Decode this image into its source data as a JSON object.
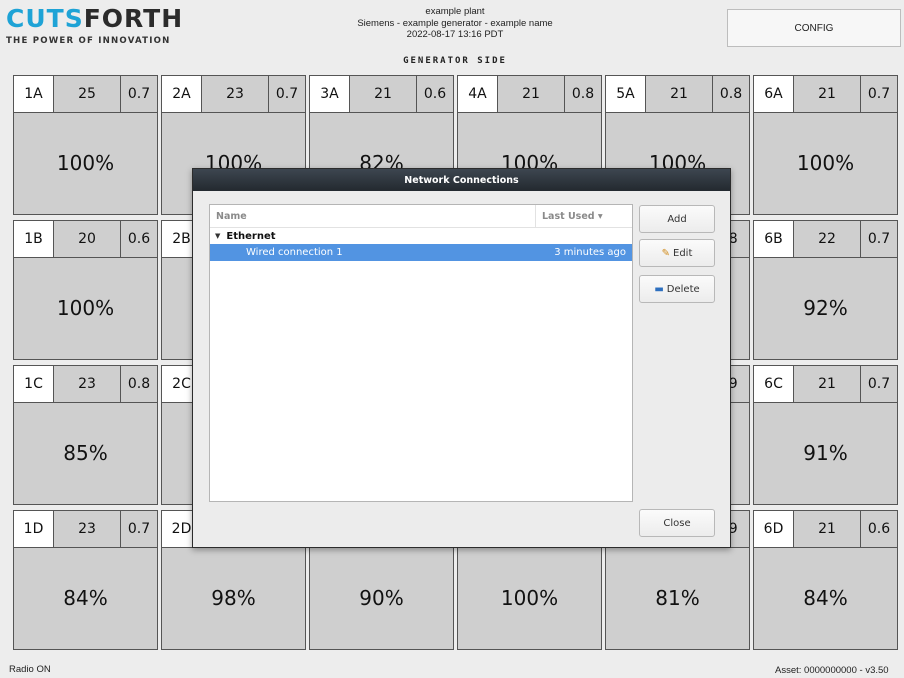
{
  "brand": {
    "name_part1": "CUTS",
    "name_part2": "FORTH",
    "tagline": "THE POWER OF INNOVATION"
  },
  "header": {
    "line1": "example plant",
    "line2": "Siemens - example generator - example name",
    "line3": "2022-08-17 13:16 PDT",
    "config_label": "CONFIG",
    "side_title": "GENERATOR SIDE"
  },
  "cells": [
    {
      "id": "1A",
      "val": "25",
      "pf": "0.7",
      "pct": "100%"
    },
    {
      "id": "2A",
      "val": "23",
      "pf": "0.7",
      "pct": "100%"
    },
    {
      "id": "3A",
      "val": "21",
      "pf": "0.6",
      "pct": "82%"
    },
    {
      "id": "4A",
      "val": "21",
      "pf": "0.8",
      "pct": "100%"
    },
    {
      "id": "5A",
      "val": "21",
      "pf": "0.8",
      "pct": "100%"
    },
    {
      "id": "6A",
      "val": "21",
      "pf": "0.7",
      "pct": "100%"
    },
    {
      "id": "1B",
      "val": "20",
      "pf": "0.6",
      "pct": "100%"
    },
    {
      "id": "2B",
      "val": "",
      "pf": "",
      "pct": ""
    },
    {
      "id": "",
      "val": "",
      "pf": "",
      "pct": ""
    },
    {
      "id": "",
      "val": "",
      "pf": "",
      "pct": ""
    },
    {
      "id": "",
      "val": "",
      "pf": ".8",
      "pct": ""
    },
    {
      "id": "6B",
      "val": "22",
      "pf": "0.7",
      "pct": "92%"
    },
    {
      "id": "1C",
      "val": "23",
      "pf": "0.8",
      "pct": "85%"
    },
    {
      "id": "2C",
      "val": "",
      "pf": "",
      "pct": ""
    },
    {
      "id": "",
      "val": "",
      "pf": "",
      "pct": ""
    },
    {
      "id": "",
      "val": "",
      "pf": "",
      "pct": ""
    },
    {
      "id": "",
      "val": "",
      "pf": ".9",
      "pct": ""
    },
    {
      "id": "6C",
      "val": "21",
      "pf": "0.7",
      "pct": "91%"
    },
    {
      "id": "1D",
      "val": "23",
      "pf": "0.7",
      "pct": "84%"
    },
    {
      "id": "2D",
      "val": "",
      "pf": "",
      "pct": "98%"
    },
    {
      "id": "",
      "val": "",
      "pf": "",
      "pct": "90%"
    },
    {
      "id": "",
      "val": "",
      "pf": "",
      "pct": "100%"
    },
    {
      "id": "",
      "val": "",
      "pf": ".9",
      "pct": "81%"
    },
    {
      "id": "6D",
      "val": "21",
      "pf": "0.6",
      "pct": "84%"
    }
  ],
  "footer": {
    "left": "Radio ON",
    "right": "Asset: 0000000000 - v3.50"
  },
  "dialog": {
    "title": "Network Connections",
    "col_name": "Name",
    "col_last_used": "Last Used",
    "sort_indicator": "▾",
    "group_label": "Ethernet",
    "group_icon": "triangle-down",
    "connection_name": "Wired connection 1",
    "connection_last_used": "3 minutes ago",
    "add_label": "Add",
    "edit_label": "Edit",
    "delete_label": "Delete",
    "close_label": "Close",
    "edit_icon": "pencil-icon",
    "delete_icon": "network-icon",
    "selection_color": "#5294e2"
  },
  "colors": {
    "brand_blue": "#1ea3d6",
    "cell_bg": "#cfcfcf",
    "dialog_title_bg": "#2f363d"
  }
}
